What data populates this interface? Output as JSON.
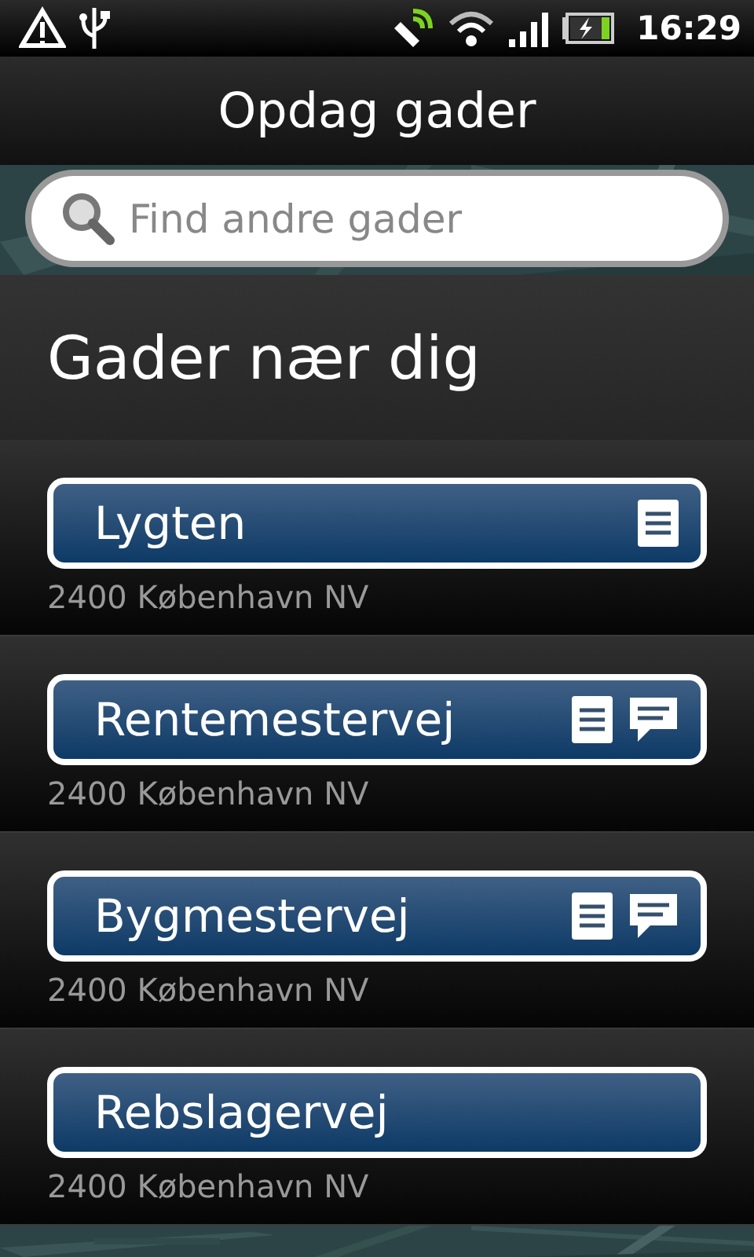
{
  "status_bar": {
    "time": "16:29"
  },
  "title": "Opdag gader",
  "search": {
    "placeholder": "Find andre gader"
  },
  "section_title": "Gader nær dig",
  "streets": [
    {
      "name": "Lygten",
      "address": "2400 København NV",
      "notes": true,
      "comments": false
    },
    {
      "name": "Rentemestervej",
      "address": "2400 København NV",
      "notes": true,
      "comments": true
    },
    {
      "name": "Bygmestervej",
      "address": "2400 København NV",
      "notes": true,
      "comments": true
    },
    {
      "name": "Rebslagervej",
      "address": "2400 København NV",
      "notes": false,
      "comments": false
    }
  ]
}
